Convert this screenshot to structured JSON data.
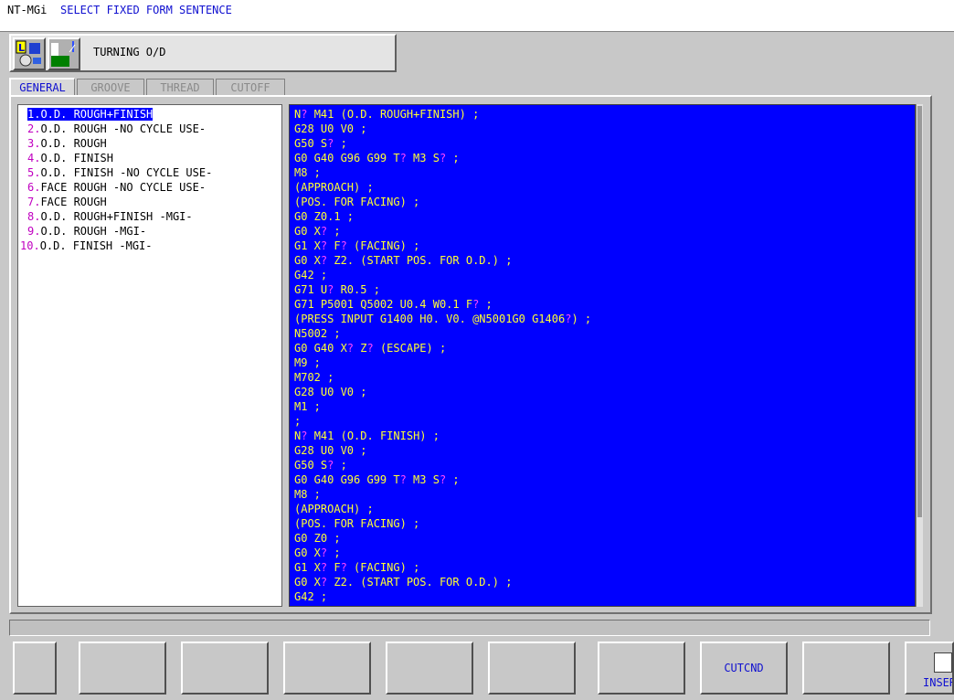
{
  "title": {
    "app": "NT-MGi",
    "mode": "SELECT FIXED FORM SENTENCE"
  },
  "header": {
    "label": "TURNING O/D",
    "icons": [
      "lathe-layout-icon",
      "turning-tool-icon"
    ]
  },
  "tabs": [
    {
      "label": "GENERAL",
      "active": true
    },
    {
      "label": "GROOVE",
      "active": false
    },
    {
      "label": "THREAD",
      "active": false
    },
    {
      "label": "CUTOFF",
      "active": false
    }
  ],
  "list": [
    {
      "num": "1.",
      "text": "O.D. ROUGH+FINISH",
      "selected": true
    },
    {
      "num": "2.",
      "text": "O.D. ROUGH -NO CYCLE USE-"
    },
    {
      "num": "3.",
      "text": "O.D. ROUGH"
    },
    {
      "num": "4.",
      "text": "O.D. FINISH"
    },
    {
      "num": "5.",
      "text": "O.D. FINISH -NO CYCLE USE-"
    },
    {
      "num": "6.",
      "text": "FACE ROUGH -NO CYCLE USE-"
    },
    {
      "num": "7.",
      "text": "FACE ROUGH"
    },
    {
      "num": "8.",
      "text": "O.D. ROUGH+FINISH -MGI-"
    },
    {
      "num": "9.",
      "text": "O.D. ROUGH -MGI-"
    },
    {
      "num": "10.",
      "text": "O.D. FINISH -MGI-"
    }
  ],
  "code": [
    "N? M41 (O.D. ROUGH+FINISH) ;",
    "G28 U0 V0 ;",
    "G50 S? ;",
    "G0 G40 G96 G99 T? M3 S? ;",
    "M8 ;",
    "(APPROACH) ;",
    "(POS. FOR FACING) ;",
    "G0 Z0.1 ;",
    "G0 X? ;",
    "G1 X? F? (FACING) ;",
    "G0 X? Z2. (START POS. FOR O.D.) ;",
    "G42 ;",
    "G71 U? R0.5 ;",
    "G71 P5001 Q5002 U0.4 W0.1 F? ;",
    "(PRESS INPUT G1400 H0. V0. @N5001G0 G1406?) ;",
    "N5002 ;",
    "G0 G40 X? Z? (ESCAPE) ;",
    "M9 ;",
    "M702 ;",
    "G28 U0 V0 ;",
    "M1 ;",
    ";",
    "N? M41 (O.D. FINISH) ;",
    "G28 U0 V0 ;",
    "G50 S? ;",
    "G0 G40 G96 G99 T? M3 S? ;",
    "M8 ;",
    "(APPROACH) ;",
    "(POS. FOR FACING) ;",
    "G0 Z0 ;",
    "G0 X? ;",
    "G1 X? F? (FACING) ;",
    "G0 X? Z2. (START POS. FOR O.D.) ;",
    "G42 ;"
  ],
  "softkeys": [
    "",
    "",
    "",
    "",
    "",
    "",
    "",
    "CUTCND",
    "",
    "INSERT"
  ],
  "colors": {
    "code_bg": "#0000ff",
    "code_text": "#ffff33",
    "placeholder_mark": "#ff44ff",
    "accent": "#1010d0"
  }
}
